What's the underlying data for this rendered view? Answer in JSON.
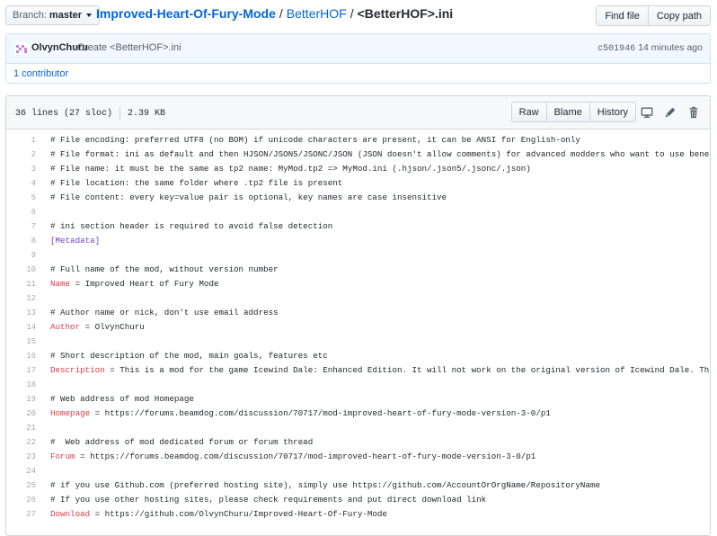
{
  "branch": {
    "label": "Branch:",
    "value": "master"
  },
  "breadcrumb": {
    "repo": "Improved-Heart-Of-Fury-Mode",
    "folder": "BetterHOF",
    "sep1": "/",
    "sep2": "/",
    "file": "<BetterHOF>.ini"
  },
  "top_buttons": {
    "find_file": "Find file",
    "copy_path": "Copy path"
  },
  "commit": {
    "author": "OlvynChuru",
    "message": "Create <BetterHOF>.ini",
    "sha": "c501946",
    "time": "14 minutes ago",
    "contributors": "1 contributor"
  },
  "file": {
    "lines": "36 lines (27 sloc)",
    "size": "2.39 KB",
    "buttons": {
      "raw": "Raw",
      "blame": "Blame",
      "history": "History"
    }
  },
  "icons": {
    "desktop": "desktop-icon",
    "edit": "pencil-icon",
    "delete": "trash-icon"
  },
  "code_lines": [
    {
      "n": "1",
      "text": "# File encoding: preferred UTF8 (no BOM) if unicode characters are present, it can be ANSI for English-only",
      "type": "comment"
    },
    {
      "n": "2",
      "text": "# File format: ini as default and then HJSON/JSON5/JSONC/JSON (JSON doesn't allow comments) for advanced modders who want to use benefits of",
      "type": "comment"
    },
    {
      "n": "3",
      "text": "# File name: it must be the same as tp2 name: MyMod.tp2 => MyMod.ini (.hjson/.json5/.jsonc/.json)",
      "type": "comment"
    },
    {
      "n": "4",
      "text": "# File location: the same folder where .tp2 file is present",
      "type": "comment"
    },
    {
      "n": "5",
      "text": "# File content: every key=value pair is optional, key names are case insensitive",
      "type": "comment"
    },
    {
      "n": "6",
      "text": "",
      "type": "blank"
    },
    {
      "n": "7",
      "text": "# ini section header is required to avoid false detection",
      "type": "comment"
    },
    {
      "n": "8",
      "text": "[Metadata]",
      "type": "section"
    },
    {
      "n": "9",
      "text": "",
      "type": "blank"
    },
    {
      "n": "10",
      "text": "# Full name of the mod, without version number",
      "type": "comment"
    },
    {
      "n": "11",
      "key": "Name",
      "value": " = Improved Heart of Fury Mode",
      "type": "kv"
    },
    {
      "n": "12",
      "text": "",
      "type": "blank"
    },
    {
      "n": "13",
      "text": "# Author name or nick, don't use email address",
      "type": "comment"
    },
    {
      "n": "14",
      "key": "Author",
      "value": " = OlvynChuru",
      "type": "kv"
    },
    {
      "n": "15",
      "text": "",
      "type": "blank"
    },
    {
      "n": "16",
      "text": "# Short description of the mod, main goals, features etc",
      "type": "comment"
    },
    {
      "n": "17",
      "key": "Description",
      "value": " = This is a mod for the game Icewind Dale: Enhanced Edition. It will not work on the original version of Icewind Dale. This mod",
      "type": "kv"
    },
    {
      "n": "18",
      "text": "",
      "type": "blank"
    },
    {
      "n": "19",
      "text": "# Web address of mod Homepage",
      "type": "comment"
    },
    {
      "n": "20",
      "key": "Homepage",
      "value": " = https://forums.beamdog.com/discussion/70717/mod-improved-heart-of-fury-mode-version-3-0/p1",
      "type": "kv"
    },
    {
      "n": "21",
      "text": "",
      "type": "blank"
    },
    {
      "n": "22",
      "text": "#  Web address of mod dedicated forum or forum thread",
      "type": "comment"
    },
    {
      "n": "23",
      "key": "Forum",
      "value": " = https://forums.beamdog.com/discussion/70717/mod-improved-heart-of-fury-mode-version-3-0/p1",
      "type": "kv"
    },
    {
      "n": "24",
      "text": "",
      "type": "blank"
    },
    {
      "n": "25",
      "text": "# if you use Github.com (preferred hosting site), simply use https://github.com/AccountOrOrgName/RepositoryName",
      "type": "comment"
    },
    {
      "n": "26",
      "text": "# If you use other hosting sites, please check requirements and put direct download link",
      "type": "comment"
    },
    {
      "n": "27",
      "key": "Download",
      "value": " = https://github.com/OlvynChuru/Improved-Heart-Of-Fury-Mode",
      "type": "kv"
    }
  ]
}
